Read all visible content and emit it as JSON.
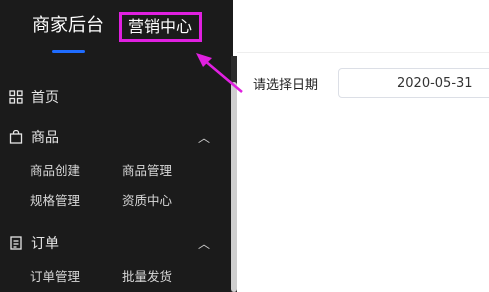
{
  "topnav": {
    "tabs": [
      {
        "label": "商家后台"
      },
      {
        "label": "营销中心"
      }
    ],
    "highlight_color": "#e020e0",
    "active_color": "#1f6cff"
  },
  "sidebar": {
    "home": {
      "label": "首页",
      "icon": "grid-icon"
    },
    "groups": [
      {
        "label": "商品",
        "icon": "bag-icon",
        "expanded": true,
        "items": [
          "商品创建",
          "商品管理",
          "规格管理",
          "资质中心"
        ]
      },
      {
        "label": "订单",
        "icon": "document-icon",
        "expanded": true,
        "items": [
          "订单管理",
          "批量发货"
        ]
      }
    ]
  },
  "main": {
    "date_label": "请选择日期",
    "date_value": "2020-05-31"
  }
}
